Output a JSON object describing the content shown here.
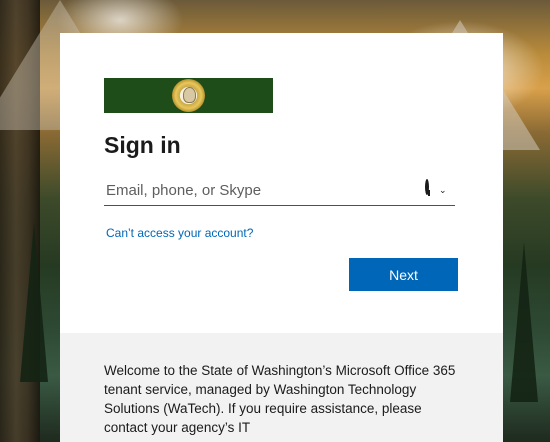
{
  "signin": {
    "title": "Sign in",
    "email_placeholder": "Email, phone, or Skype",
    "email_value": "",
    "cant_access_link": "Can’t access your account?",
    "next_label": "Next"
  },
  "logo": {
    "banner_color": "#1e4d19",
    "icon": "washington-state-seal-icon"
  },
  "footer": {
    "welcome_text": "Welcome to the State of Washington’s Microsoft Office 365 tenant service, managed by Washington Technology Solutions (WaTech). If you require assistance, please contact your agency’s IT"
  },
  "colors": {
    "accent": "#0067b8",
    "card_bg": "#ffffff",
    "footer_bg": "#f2f2f2",
    "title_text": "#1b1b1b"
  }
}
